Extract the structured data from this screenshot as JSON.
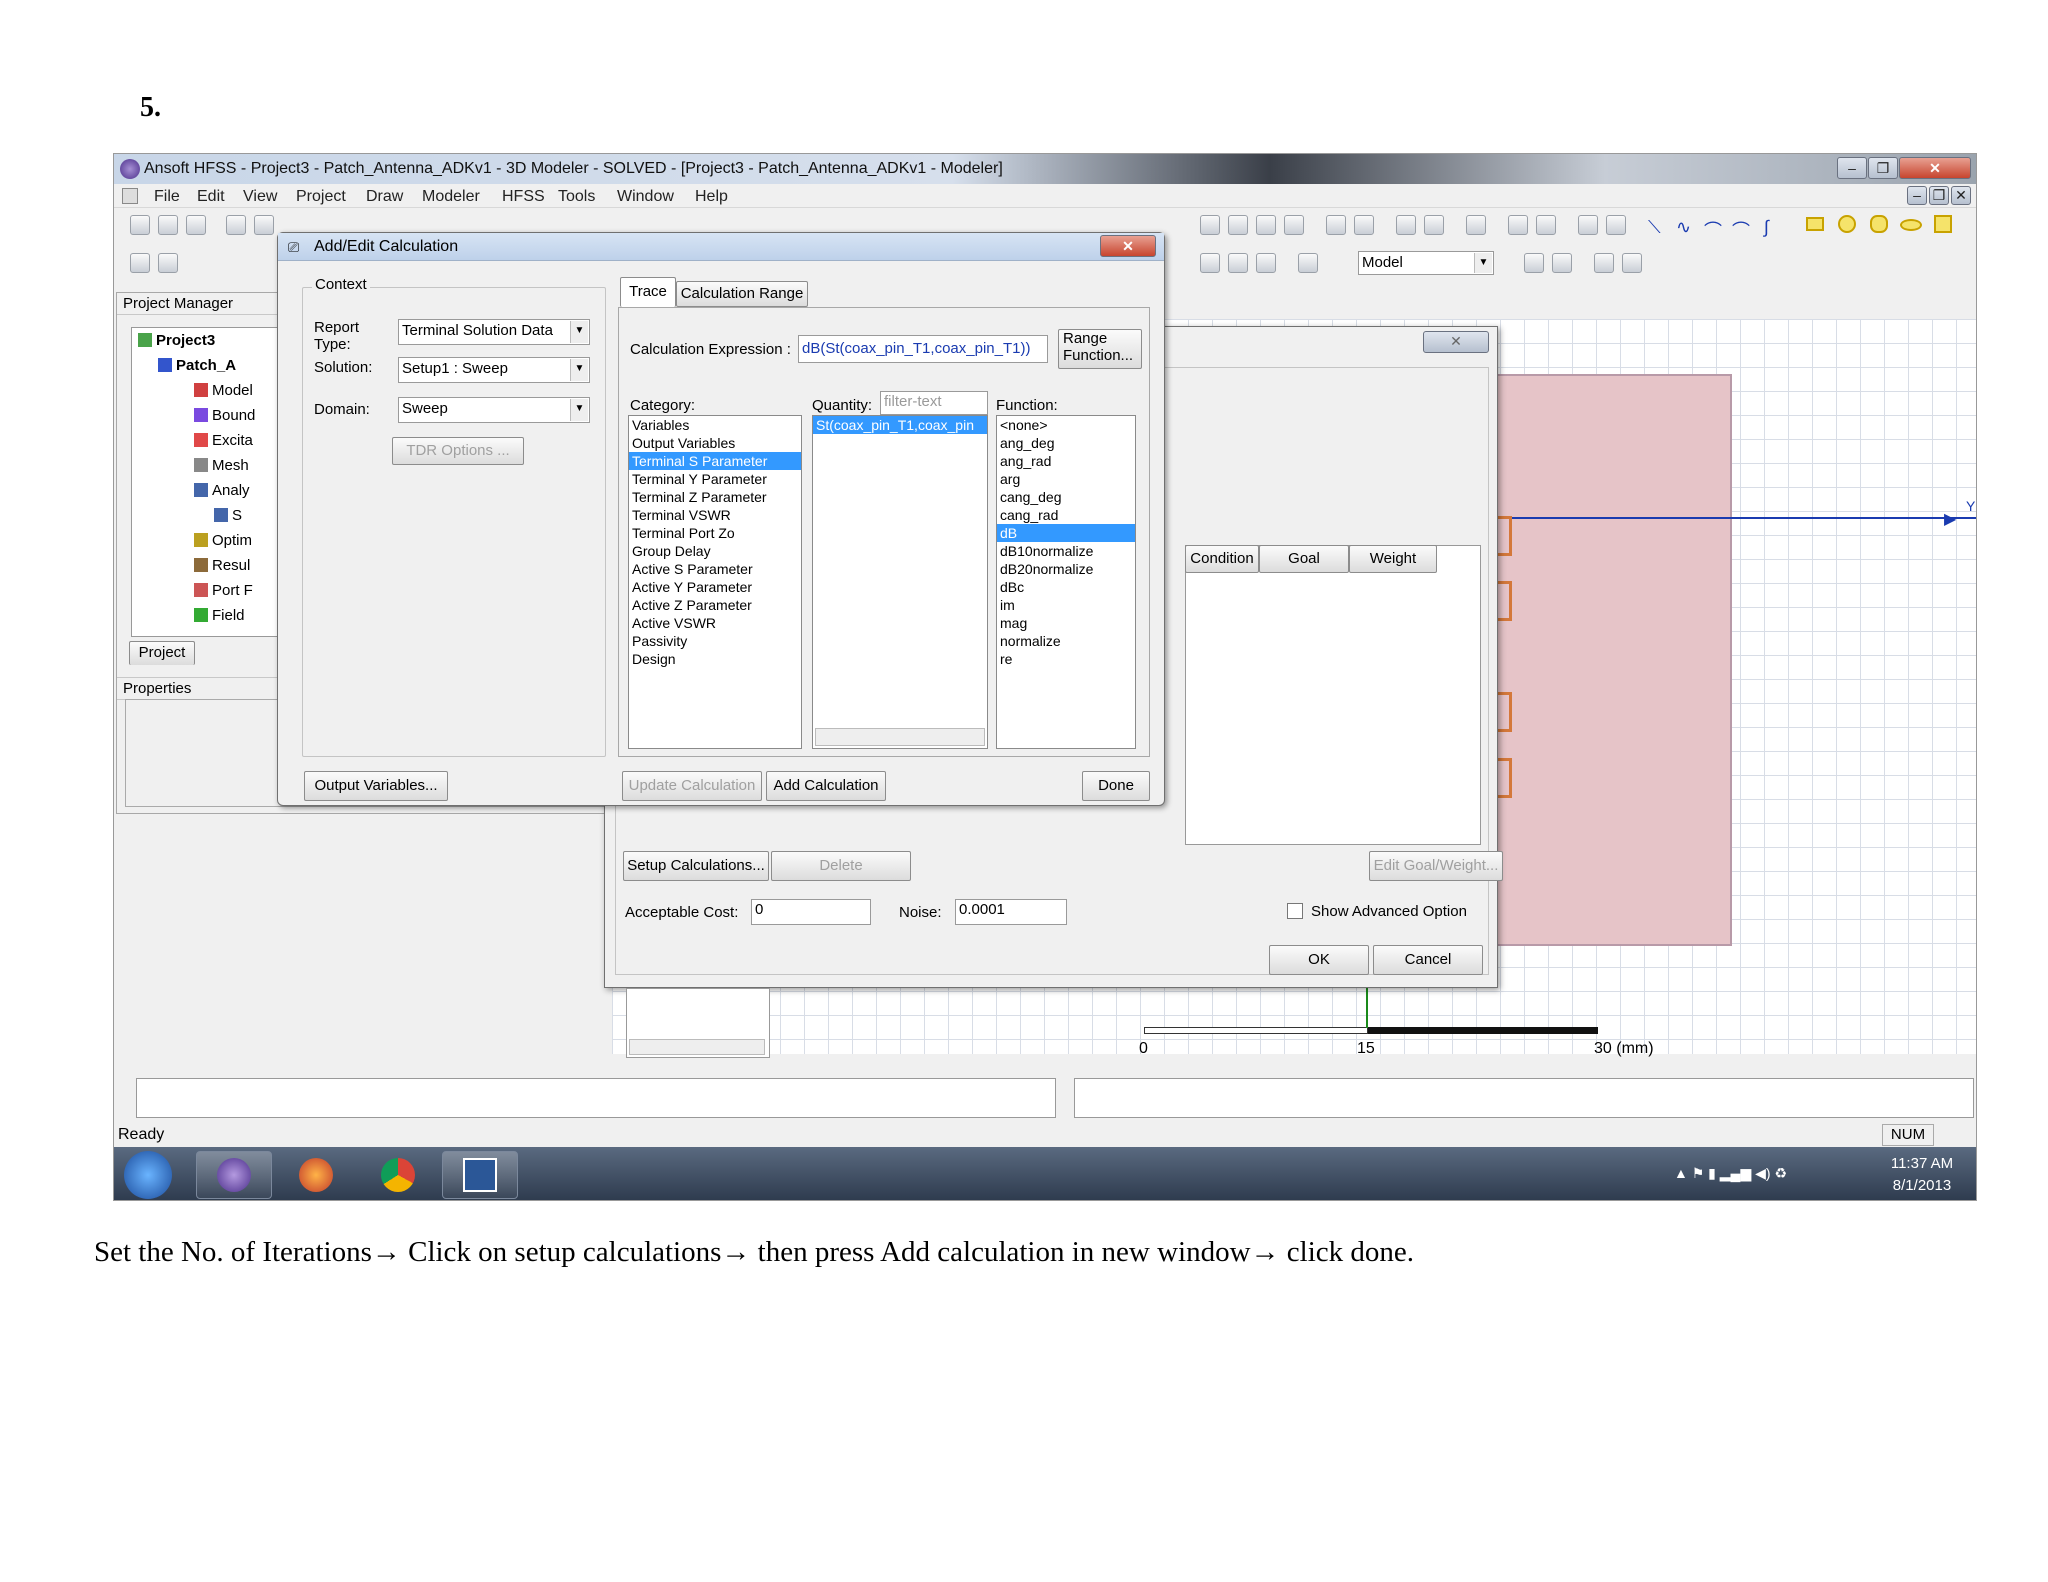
{
  "step_label": "5.",
  "caption": "Set the No. of Iterations→ Click on setup calculations→ then press Add calculation in new window→ click done.",
  "app": {
    "title": "Ansoft HFSS  - Project3 - Patch_Antenna_ADKv1 - 3D Modeler - SOLVED - [Project3 - Patch_Antenna_ADKv1 - Modeler]",
    "menu": [
      "File",
      "Edit",
      "View",
      "Project",
      "Draw",
      "Modeler",
      "HFSS",
      "Tools",
      "Window",
      "Help"
    ],
    "toolbar_model_select": "Model",
    "project_manager": {
      "header": "Project Manager",
      "tree": [
        "Project3",
        "Patch_A",
        "Model",
        "Bound",
        "Excita",
        "Mesh",
        "Analy",
        "S",
        "Optim",
        "Resul",
        "Port F",
        "Field"
      ],
      "tab": "Project"
    },
    "properties_header": "Properties",
    "status": "Ready",
    "num_indicator": "NUM",
    "ruler": {
      "labels": [
        "0",
        "15",
        "30 (mm)"
      ]
    },
    "axis_label": "Y",
    "clock": {
      "time": "11:37 AM",
      "date": "8/1/2013"
    },
    "colors": {
      "selection": "#3399ff",
      "patch": "#e8c8c8",
      "accent": "#1a3bb0"
    }
  },
  "optimetrics": {
    "columns": [
      "Condition",
      "Goal",
      "Weight"
    ],
    "setup_calculations": "Setup Calculations...",
    "delete": "Delete",
    "edit_goal_weight": "Edit Goal/Weight...",
    "acceptable_cost_label": "Acceptable Cost:",
    "acceptable_cost": "0",
    "noise_label": "Noise:",
    "noise": "0.0001",
    "show_advanced": "Show Advanced Option",
    "ok": "OK",
    "cancel": "Cancel",
    "close_glyph": "✕"
  },
  "calc_dialog": {
    "title": "Add/Edit Calculation",
    "context_label": "Context",
    "report_type_label": "Report Type:",
    "report_type": "Terminal Solution Data",
    "solution_label": "Solution:",
    "solution": "Setup1 : Sweep",
    "domain_label": "Domain:",
    "domain": "Sweep",
    "tdr_options": "TDR Options ...",
    "tabs": [
      "Trace",
      "Calculation Range"
    ],
    "calc_expr_label": "Calculation Expression :",
    "calc_expr": "dB(St(coax_pin_T1,coax_pin_T1))",
    "range_function": "Range Function...",
    "category_label": "Category:",
    "categories": [
      "Variables",
      "Output Variables",
      "Terminal S Parameter",
      "Terminal Y Parameter",
      "Terminal Z Parameter",
      "Terminal VSWR",
      "Terminal Port Zo",
      "Group Delay",
      "Active S Parameter",
      "Active Y Parameter",
      "Active Z Parameter",
      "Active VSWR",
      "Passivity",
      "Design"
    ],
    "category_selected": 2,
    "quantity_label": "Quantity:",
    "quantity_filter_placeholder": "filter-text",
    "quantities": [
      "St(coax_pin_T1,coax_pin"
    ],
    "function_label": "Function:",
    "functions": [
      "<none>",
      "ang_deg",
      "ang_rad",
      "arg",
      "cang_deg",
      "cang_rad",
      "dB",
      "dB10normalize",
      "dB20normalize",
      "dBc",
      "im",
      "mag",
      "normalize",
      "re"
    ],
    "function_selected": 6,
    "output_variables": "Output Variables...",
    "update_calculation": "Update Calculation",
    "add_calculation": "Add Calculation",
    "done": "Done",
    "close_glyph": "✕"
  }
}
